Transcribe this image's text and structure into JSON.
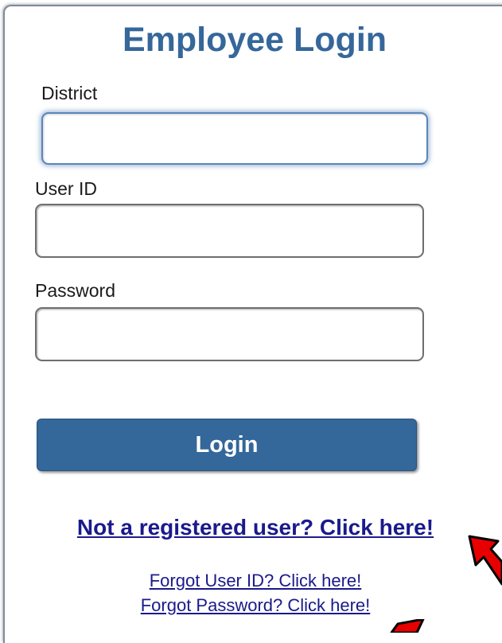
{
  "form": {
    "title": "Employee Login",
    "district_label": "District",
    "district_value": "",
    "userid_label": "User ID",
    "userid_value": "",
    "password_label": "Password",
    "password_value": "",
    "login_label": "Login"
  },
  "links": {
    "register": "Not a registered user? Click here!",
    "forgot_userid": "Forgot User ID? Click here!",
    "forgot_password": "Forgot Password? Click here!"
  },
  "colors": {
    "title": "#36679a",
    "button": "#34679a",
    "link": "#1a1a8c",
    "arrow": "#e80000"
  },
  "annotations": {
    "arrow_icons": [
      "red-arrow-icon",
      "red-arrow-icon"
    ]
  }
}
